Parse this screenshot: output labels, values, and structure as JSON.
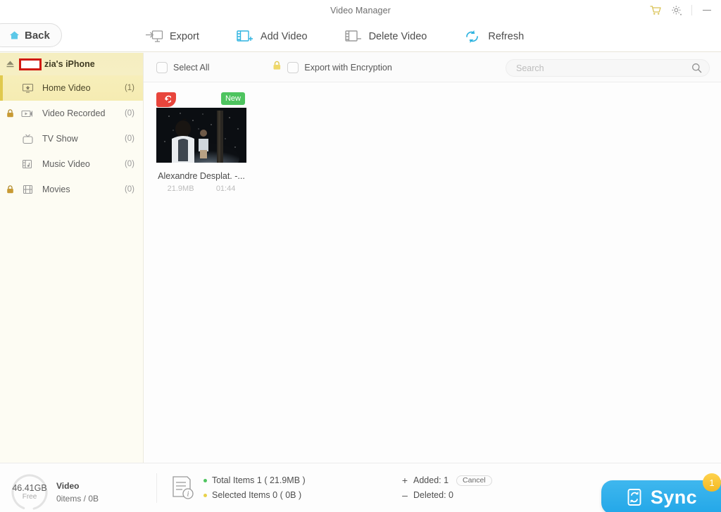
{
  "titlebar": {
    "title": "Video Manager",
    "cart_icon": "shopping-cart-icon",
    "settings_icon": "gear-icon",
    "minimize_label": "—"
  },
  "toolbar": {
    "back_label": "Back",
    "items": [
      {
        "label": "Export",
        "icon": "export-monitor-icon"
      },
      {
        "label": "Add Video",
        "icon": "add-video-icon"
      },
      {
        "label": "Delete Video",
        "icon": "delete-video-icon"
      },
      {
        "label": "Refresh",
        "icon": "refresh-icon"
      }
    ]
  },
  "sidebar": {
    "device_name": "zia's iPhone",
    "eject_icon": "eject-icon",
    "categories": [
      {
        "label": "Home Video",
        "count": "(1)",
        "locked": false,
        "selected": true,
        "icon": "home-video-icon"
      },
      {
        "label": "Video Recorded",
        "count": "(0)",
        "locked": true,
        "selected": false,
        "icon": "camcorder-icon"
      },
      {
        "label": "TV Show",
        "count": "(0)",
        "locked": false,
        "selected": false,
        "icon": "tv-icon"
      },
      {
        "label": "Music Video",
        "count": "(0)",
        "locked": false,
        "selected": false,
        "icon": "music-video-icon"
      },
      {
        "label": "Movies",
        "count": "(0)",
        "locked": true,
        "selected": false,
        "icon": "film-icon"
      }
    ]
  },
  "main": {
    "select_all_label": "Select All",
    "encryption_label": "Export with Encryption",
    "lock_icon": "lock-icon",
    "search_placeholder": "Search",
    "search_value": "",
    "search_icon": "search-icon",
    "videos": [
      {
        "title": "Alexandre Desplat. -...",
        "size": "21.9MB",
        "duration": "01:44",
        "badge_new": "New",
        "badge_revert_icon": "revert-icon"
      }
    ]
  },
  "bottombar": {
    "storage_free": "46.41GB",
    "storage_free_label": "Free",
    "storage_title": "Video",
    "storage_detail": "0items / 0B",
    "info_icon": "info-document-icon",
    "total_items_label": "Total Items 1 ( 21.9MB )",
    "selected_items_label": "Selected Items 0 ( 0B )",
    "added_label": "Added: 1",
    "deleted_label": "Deleted: 0",
    "cancel_label": "Cancel",
    "sync_label": "Sync",
    "sync_badge": "1",
    "sync_icon": "sync-device-icon"
  },
  "colors": {
    "accent_cyan": "#29a9e1",
    "sidebar_highlight": "#f5ecb2",
    "badge_new_green": "#4ec45f",
    "badge_revert_red": "#e8453c",
    "sync_blue": "#23a7e8",
    "sync_badge_yellow": "#f3b822",
    "redaction_red": "#d01a12",
    "total_dot": "#4ec45f",
    "selected_dot": "#e8d14a"
  }
}
